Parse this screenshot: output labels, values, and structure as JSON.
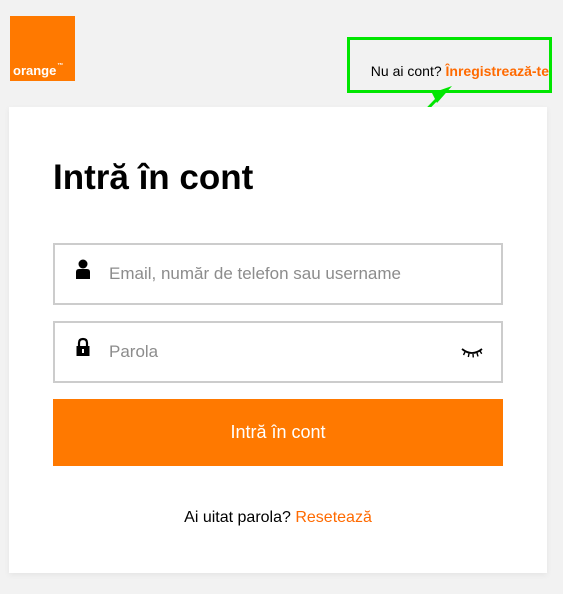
{
  "brand": {
    "logo_text": "orange",
    "logo_tm": "™",
    "color": "#ff7900"
  },
  "header": {
    "register_prompt": "Nu ai cont?",
    "register_link": "Înregistrează-te"
  },
  "annotation": {
    "highlight_color": "#00e600"
  },
  "login": {
    "title": "Intră în cont",
    "email_placeholder": "Email, număr de telefon sau username",
    "password_placeholder": "Parola",
    "submit_label": "Intră în cont",
    "forgot_prompt": "Ai uitat parola?",
    "reset_link": "Resetează"
  },
  "icons": {
    "user": "user-icon",
    "lock": "lock-icon",
    "password_toggle": "eye-closed-icon"
  }
}
